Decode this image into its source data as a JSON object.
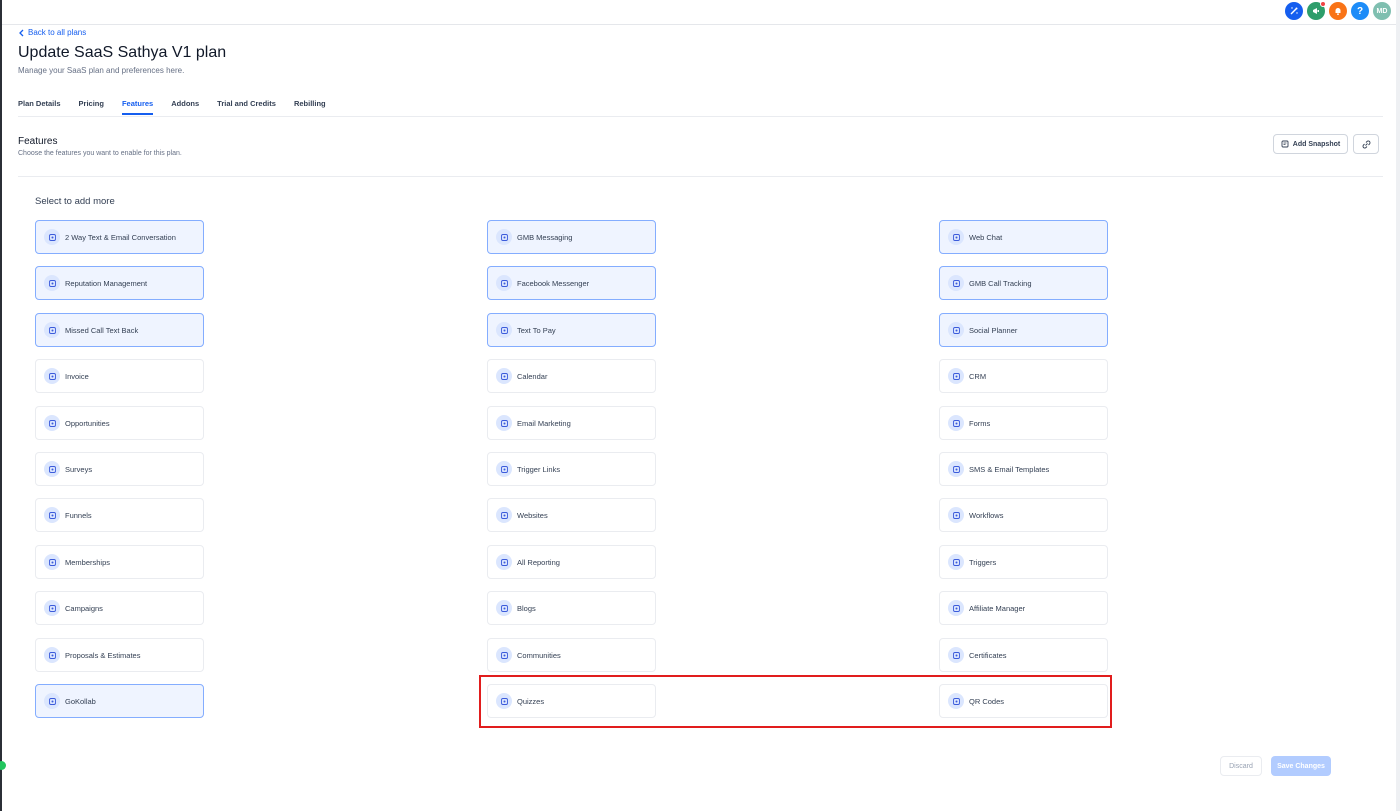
{
  "header": {
    "back_label": "Back to all plans",
    "title": "Update SaaS Sathya V1 plan",
    "subtitle": "Manage your SaaS plan and preferences here.",
    "avatar_initials": "MD",
    "help_glyph": "?"
  },
  "tabs": [
    {
      "label": "Plan Details",
      "active": false
    },
    {
      "label": "Pricing",
      "active": false
    },
    {
      "label": "Features",
      "active": true
    },
    {
      "label": "Addons",
      "active": false
    },
    {
      "label": "Trial and Credits",
      "active": false
    },
    {
      "label": "Rebilling",
      "active": false
    }
  ],
  "features_section": {
    "title": "Features",
    "subtitle": "Choose the features you want to enable for this plan.",
    "add_snapshot_label": "Add Snapshot",
    "select_label": "Select to add more"
  },
  "features": [
    {
      "label": "2 Way Text & Email Conversation",
      "selected": true,
      "icon": "chat-icon"
    },
    {
      "label": "GMB Messaging",
      "selected": true,
      "icon": "message-icon"
    },
    {
      "label": "Web Chat",
      "selected": true,
      "icon": "webchat-icon"
    },
    {
      "label": "Reputation Management",
      "selected": true,
      "icon": "reputation-icon"
    },
    {
      "label": "Facebook Messenger",
      "selected": true,
      "icon": "messenger-icon"
    },
    {
      "label": "GMB Call Tracking",
      "selected": true,
      "icon": "call-tracking-icon"
    },
    {
      "label": "Missed Call Text Back",
      "selected": true,
      "icon": "missed-call-icon"
    },
    {
      "label": "Text To Pay",
      "selected": true,
      "icon": "text-to-pay-icon"
    },
    {
      "label": "Social Planner",
      "selected": true,
      "icon": "social-icon"
    },
    {
      "label": "Invoice",
      "selected": false,
      "icon": "invoice-icon"
    },
    {
      "label": "Calendar",
      "selected": false,
      "icon": "calendar-icon"
    },
    {
      "label": "CRM",
      "selected": false,
      "icon": "crm-icon"
    },
    {
      "label": "Opportunities",
      "selected": false,
      "icon": "opportunities-icon"
    },
    {
      "label": "Email Marketing",
      "selected": false,
      "icon": "email-icon"
    },
    {
      "label": "Forms",
      "selected": false,
      "icon": "forms-icon"
    },
    {
      "label": "Surveys",
      "selected": false,
      "icon": "surveys-icon"
    },
    {
      "label": "Trigger Links",
      "selected": false,
      "icon": "trigger-links-icon"
    },
    {
      "label": "SMS & Email Templates",
      "selected": false,
      "icon": "templates-icon"
    },
    {
      "label": "Funnels",
      "selected": false,
      "icon": "funnel-icon"
    },
    {
      "label": "Websites",
      "selected": false,
      "icon": "website-icon"
    },
    {
      "label": "Workflows",
      "selected": false,
      "icon": "workflow-icon"
    },
    {
      "label": "Memberships",
      "selected": false,
      "icon": "membership-icon"
    },
    {
      "label": "All Reporting",
      "selected": false,
      "icon": "reporting-icon"
    },
    {
      "label": "Triggers",
      "selected": false,
      "icon": "triggers-icon"
    },
    {
      "label": "Campaigns",
      "selected": false,
      "icon": "campaign-icon"
    },
    {
      "label": "Blogs",
      "selected": false,
      "icon": "blog-icon"
    },
    {
      "label": "Affiliate Manager",
      "selected": false,
      "icon": "affiliate-icon"
    },
    {
      "label": "Proposals & Estimates",
      "selected": false,
      "icon": "proposal-icon"
    },
    {
      "label": "Communities",
      "selected": false,
      "icon": "communities-icon"
    },
    {
      "label": "Certificates",
      "selected": false,
      "icon": "certificate-icon"
    },
    {
      "label": "GoKollab",
      "selected": true,
      "icon": "gokollab-icon"
    },
    {
      "label": "Quizzes",
      "selected": false,
      "icon": "quiz-icon"
    },
    {
      "label": "QR Codes",
      "selected": false,
      "icon": "qr-code-icon"
    }
  ],
  "footer": {
    "discard_label": "Discard",
    "save_label": "Save Changes"
  },
  "colors": {
    "accent": "#155eef",
    "highlight": "#e11d1d"
  }
}
